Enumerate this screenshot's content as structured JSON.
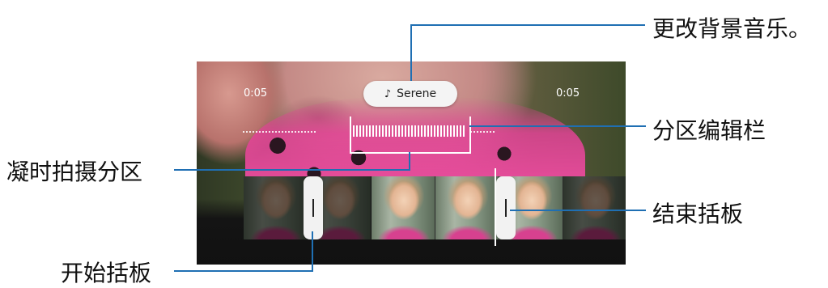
{
  "player": {
    "time_start": "0:05",
    "time_end": "0:05",
    "music": {
      "icon": "music-note-icon",
      "label": "Serene"
    }
  },
  "callouts": {
    "change_bgm": "更改背景音乐。",
    "segment_edit_bar": "分区编辑栏",
    "hyperlapse_segment": "凝时拍摄分区",
    "end_handle": "结束括板",
    "start_handle": "开始括板"
  },
  "colors": {
    "callout_line": "#1f6fb3",
    "pill_bg": "#f4f4f4",
    "handle_bg": "#f2f2f2"
  }
}
